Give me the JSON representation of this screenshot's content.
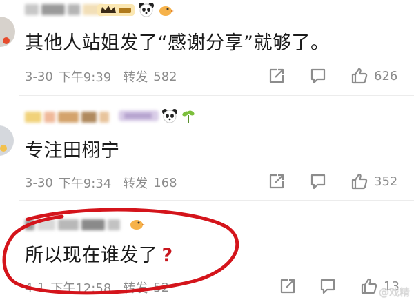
{
  "comments": [
    {
      "text": "其他人站姐发了“感谢分享”就够了。",
      "date": "3-30",
      "time": "下午9:39",
      "repost_label": "转发",
      "repost_count": "582",
      "likes": "626"
    },
    {
      "text": "专注田栩宁",
      "date": "3-30",
      "time": "下午9:34",
      "repost_label": "转发",
      "repost_count": "168",
      "likes": "352"
    },
    {
      "text": "所以现在谁发了",
      "emphasis": "?",
      "date": "4-1",
      "time": "下午12:58",
      "repost_label": "转发",
      "repost_count": "52",
      "likes": "13"
    }
  ],
  "watermark": "@戏精",
  "icons": {
    "share": "share-icon",
    "comment": "comment-icon",
    "like": "thumbs-up-icon",
    "panda": "panda-icon",
    "sprout": "sprout-icon",
    "crown": "crown-icon"
  },
  "colors": {
    "annotation_circle": "#d4141b",
    "text": "#1a1a1a",
    "meta": "#8c8c8c"
  }
}
